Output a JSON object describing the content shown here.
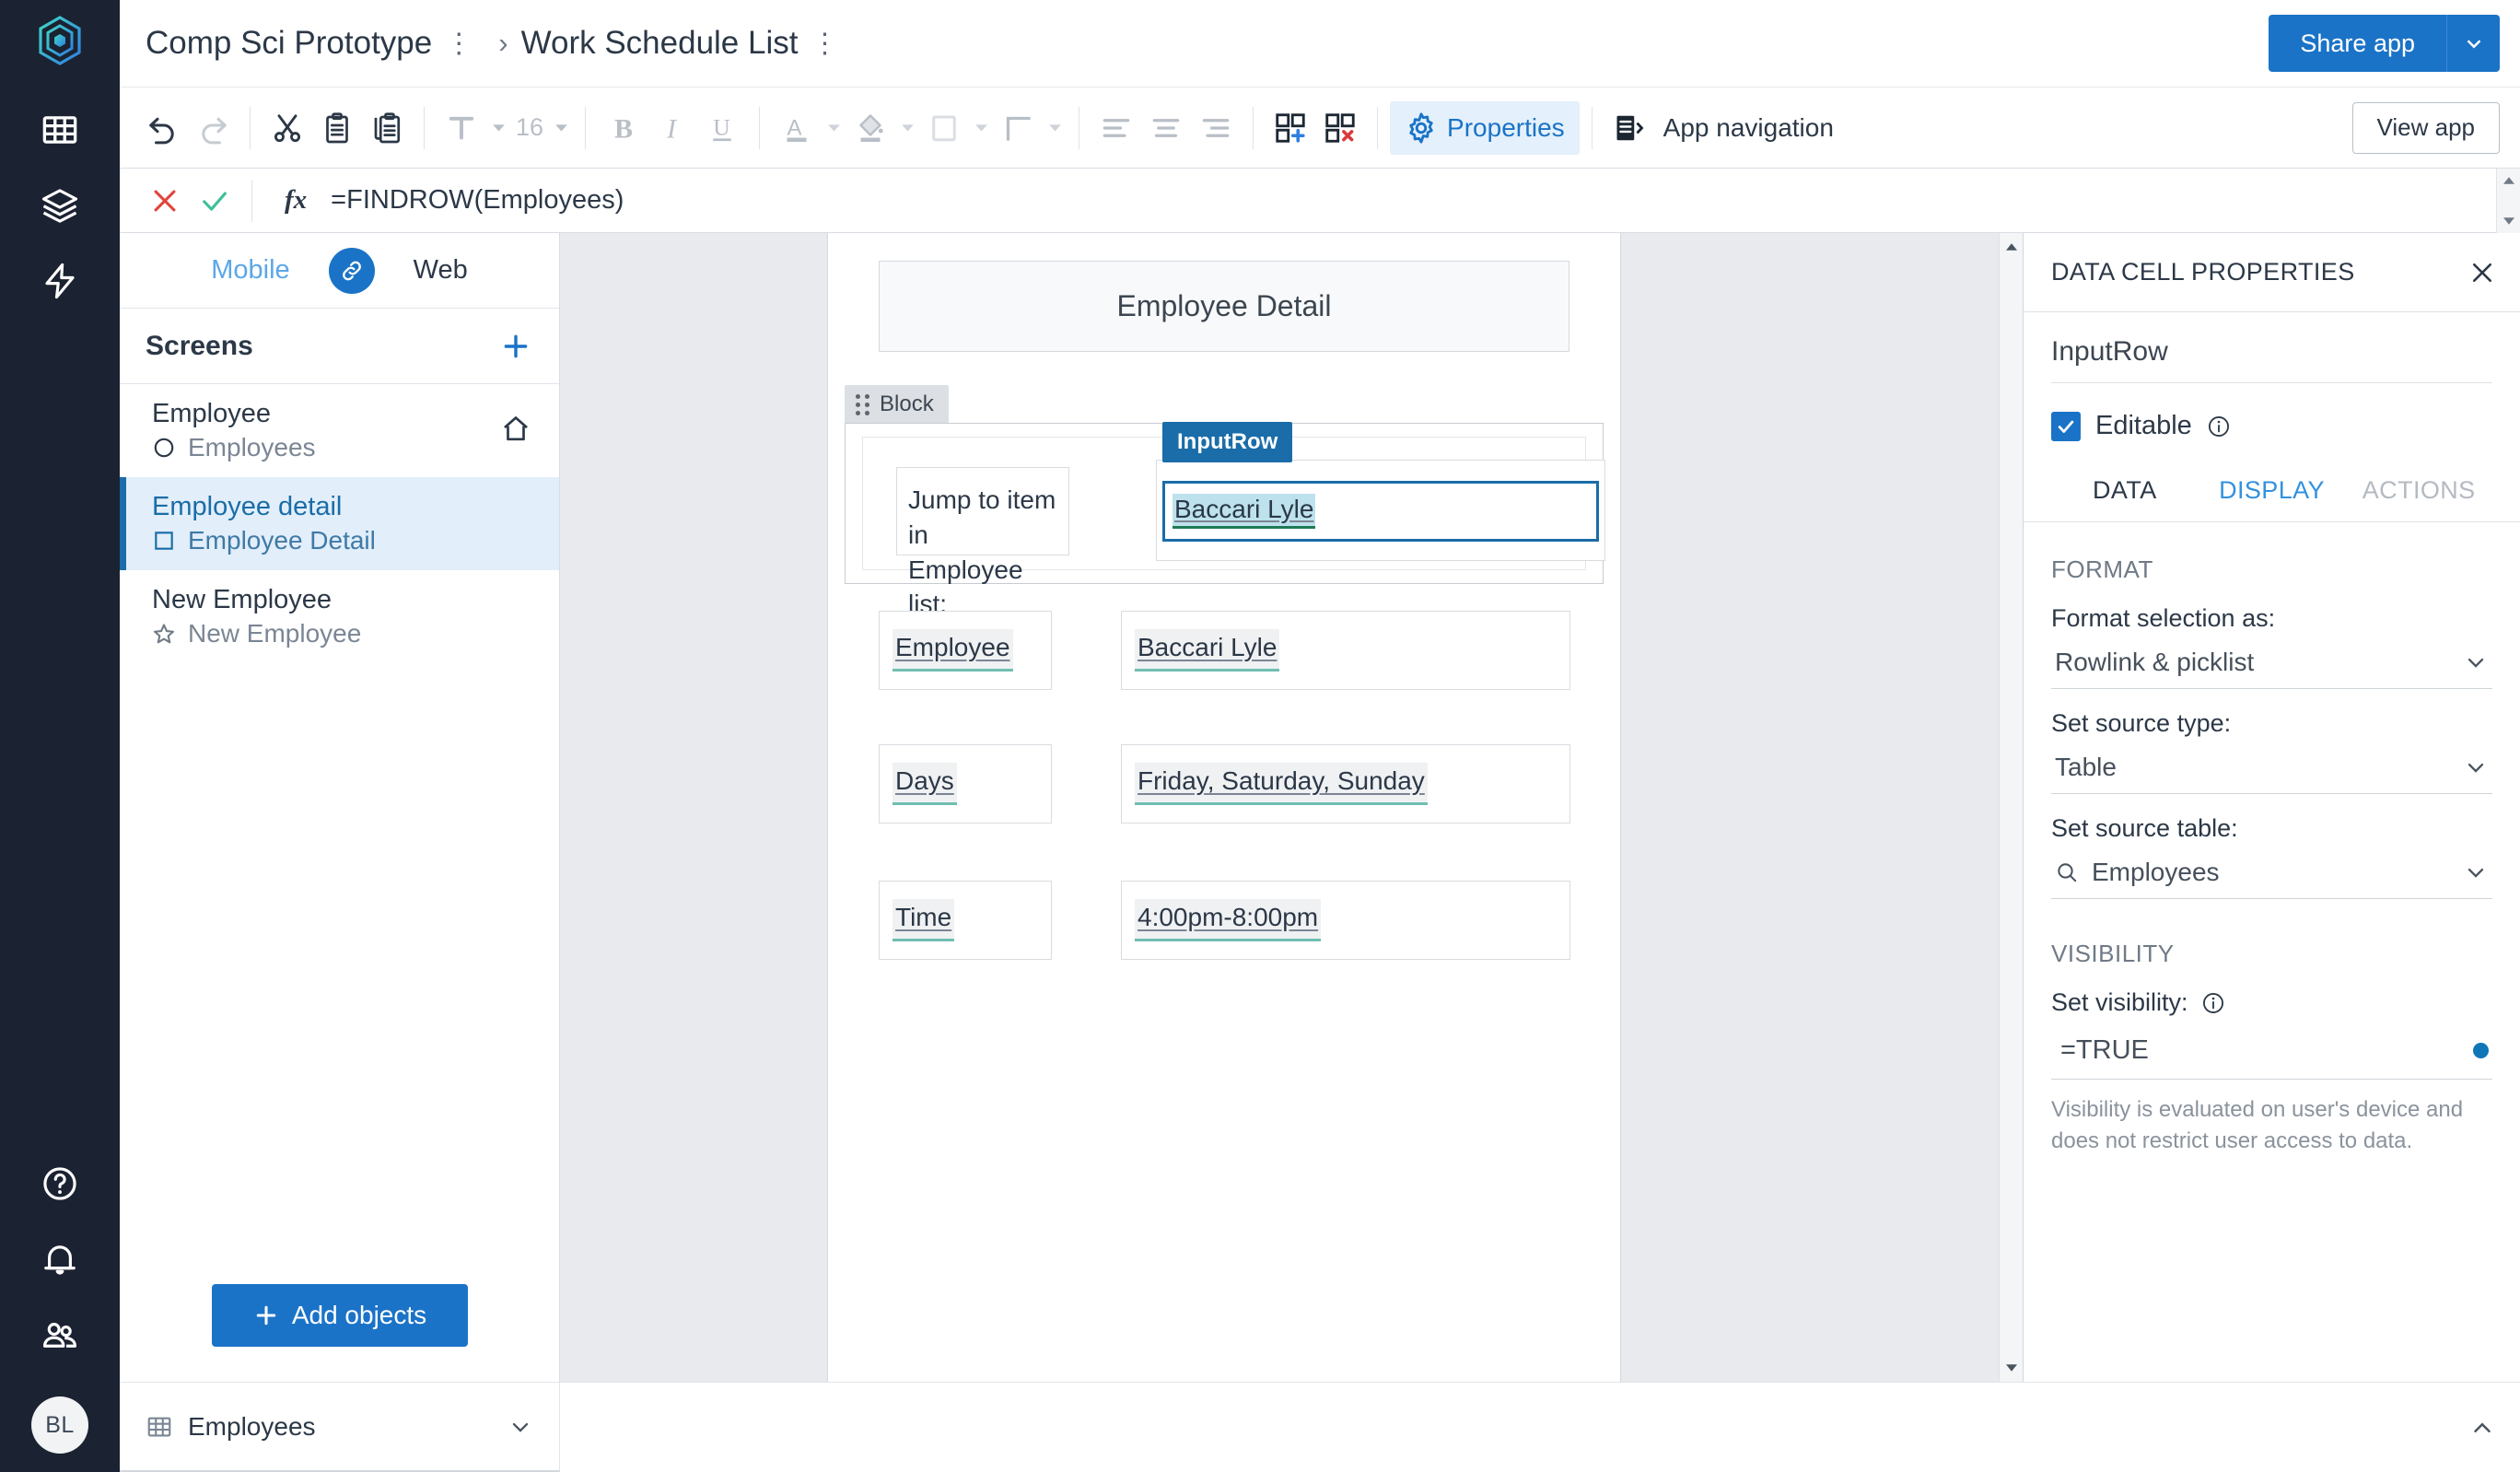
{
  "rail": {
    "logo_icon": "appsheet-hex-logo",
    "items": [
      {
        "icon": "table-grid-icon",
        "name": "data"
      },
      {
        "icon": "layers-stack-icon",
        "name": "layouts"
      },
      {
        "icon": "lightning-bolt-icon",
        "name": "automation"
      }
    ],
    "bottom_items": [
      {
        "icon": "help-circle-icon",
        "name": "help"
      },
      {
        "icon": "bell-icon",
        "name": "notifications"
      },
      {
        "icon": "people-icon",
        "name": "users"
      }
    ],
    "avatar_initials": "BL"
  },
  "titlebar": {
    "app_name": "Comp Sci Prototype",
    "app_menu_icon": "kebab-menu-icon",
    "separator_icon": "chevron-right-icon",
    "sheet_name": "Work Schedule List",
    "sheet_menu_icon": "kebab-menu-icon",
    "share_label": "Share app",
    "share_caret_icon": "chevron-down-icon"
  },
  "toolbar": {
    "undo": {
      "label": "Undo",
      "icon": "undo-arrow-icon",
      "enabled": true
    },
    "redo": {
      "label": "Redo",
      "icon": "redo-arrow-icon",
      "enabled": false
    },
    "cut": {
      "label": "Cut",
      "icon": "scissors-icon"
    },
    "paste": {
      "label": "Paste",
      "icon": "clipboard-icon"
    },
    "copy": {
      "label": "Copy",
      "icon": "copy-icon"
    },
    "font": {
      "label": "Font",
      "icon": "text-format-icon"
    },
    "font_size": "16",
    "bold": {
      "label": "Bold",
      "icon": "bold-icon"
    },
    "italic": {
      "label": "Italic",
      "icon": "italic-icon"
    },
    "underline": {
      "label": "Underline",
      "icon": "underline-icon"
    },
    "text_color": {
      "label": "Text color",
      "icon": "text-color-icon"
    },
    "fill_color": {
      "label": "Fill color",
      "icon": "fill-color-icon"
    },
    "cell_fill": {
      "label": "Cell style",
      "icon": "square-outline-icon"
    },
    "borders": {
      "label": "Borders",
      "icon": "border-corner-icon"
    },
    "align_left": {
      "label": "Align left",
      "icon": "align-left-icon"
    },
    "align_center": {
      "label": "Align center",
      "icon": "align-center-icon"
    },
    "align_right": {
      "label": "Align right",
      "icon": "align-right-icon"
    },
    "add_block": {
      "label": "Add block",
      "icon": "add-block-icon"
    },
    "remove_block": {
      "label": "Remove block",
      "icon": "remove-block-icon"
    },
    "properties": {
      "label": "Properties",
      "icon": "gear-icon",
      "active": true
    },
    "app_navigation": {
      "label": "App navigation",
      "icon": "app-nav-icon"
    },
    "view_app": {
      "label": "View app"
    }
  },
  "formula_bar": {
    "cancel_icon": "red-x-icon",
    "confirm_icon": "green-check-icon",
    "fx_label": "fx",
    "formula": "=FINDROW(Employees)"
  },
  "screens_panel": {
    "platform_tabs": {
      "mobile": "Mobile",
      "web": "Web",
      "link_icon": "link-chain-icon"
    },
    "header": "Screens",
    "add_icon": "plus-icon",
    "items": [
      {
        "title": "Employee",
        "subtitle": "Employees",
        "icon": "circle-outline-icon",
        "home_icon": "home-icon",
        "active": false
      },
      {
        "title": "Employee detail",
        "subtitle": "Employee Detail",
        "icon": "square-outline-icon",
        "active": true
      },
      {
        "title": "New Employee",
        "subtitle": "New Employee",
        "icon": "star-outline-icon",
        "active": false
      }
    ],
    "add_objects_label": "Add objects",
    "add_objects_icon": "plus-icon"
  },
  "canvas": {
    "header_title": "Employee Detail",
    "block_label": "Block",
    "block_grip_icon": "drag-grip-icon",
    "jump_text_line1": "Jump to item in",
    "jump_text_line2": "Employee list:",
    "input_row_tag": "InputRow",
    "input_row_value": "Baccari Lyle",
    "rows": [
      {
        "label": "Employee",
        "value": "Baccari Lyle"
      },
      {
        "label": "Days",
        "value": "Friday, Saturday, Sunday"
      },
      {
        "label": "Time",
        "value": "4:00pm-8:00pm"
      }
    ],
    "scroll_up_icon": "chevron-up-icon",
    "scroll_down_icon": "chevron-down-icon"
  },
  "properties_panel": {
    "title": "DATA CELL PROPERTIES",
    "close_icon": "close-x-icon",
    "cell_name": "InputRow",
    "editable": {
      "label": "Editable",
      "checked": true,
      "check_icon": "check-icon",
      "info_icon": "info-circle-icon"
    },
    "tabs": [
      {
        "label": "DATA",
        "state": "selected"
      },
      {
        "label": "DISPLAY",
        "state": "hover"
      },
      {
        "label": "ACTIONS",
        "state": "disabled"
      }
    ],
    "format_section": {
      "heading": "FORMAT",
      "fields": [
        {
          "label": "Format selection as:",
          "value": "Rowlink & picklist",
          "icon": null,
          "caret_icon": "chevron-down-icon"
        },
        {
          "label": "Set source type:",
          "value": "Table",
          "icon": null,
          "caret_icon": "chevron-down-icon"
        },
        {
          "label": "Set source table:",
          "value": "Employees",
          "icon": "search-icon",
          "caret_icon": "chevron-down-icon"
        }
      ]
    },
    "visibility_section": {
      "heading": "VISIBILITY",
      "field_label": "Set visibility:",
      "info_icon": "info-circle-icon",
      "value": "=TRUE",
      "status_dot_color": "#1176b8",
      "note": "Visibility is evaluated on user's device and does not restrict user access to data."
    }
  },
  "bottom_bar": {
    "sheet_name": "Employees",
    "sheet_icon": "table-grid-icon",
    "sheet_caret_icon": "chevron-down-icon",
    "collapse_icon": "chevron-up-icon"
  },
  "colors": {
    "accent_blue": "#1a73c7",
    "rail_dark": "#1b2231",
    "selection_blue": "#1a6da8",
    "highlight_teal": "#6fbfb0",
    "canvas_gray": "#e8eaed"
  }
}
